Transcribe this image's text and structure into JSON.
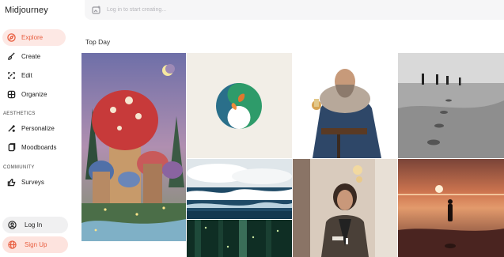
{
  "app": {
    "brand": "Midjourney"
  },
  "nav": {
    "items": [
      {
        "label": "Explore",
        "icon": "compass-icon",
        "active": true
      },
      {
        "label": "Create",
        "icon": "brush-icon"
      },
      {
        "label": "Edit",
        "icon": "edit-icon"
      },
      {
        "label": "Organize",
        "icon": "grid-icon"
      }
    ],
    "aesthetics_heading": "AESTHETICS",
    "aesthetics_items": [
      {
        "label": "Personalize",
        "icon": "personalize-icon"
      },
      {
        "label": "Moodboards",
        "icon": "moodboard-icon"
      }
    ],
    "community_heading": "COMMUNITY",
    "community_items": [
      {
        "label": "Surveys",
        "icon": "thumbs-up-icon"
      }
    ]
  },
  "auth": {
    "login_label": "Log In",
    "signup_label": "Sign Up"
  },
  "search": {
    "placeholder": "Log in to start creating..."
  },
  "gallery": {
    "title": "Top Day"
  },
  "colors": {
    "accent": "#e85d3f",
    "accent_bg": "#fde8e4"
  }
}
